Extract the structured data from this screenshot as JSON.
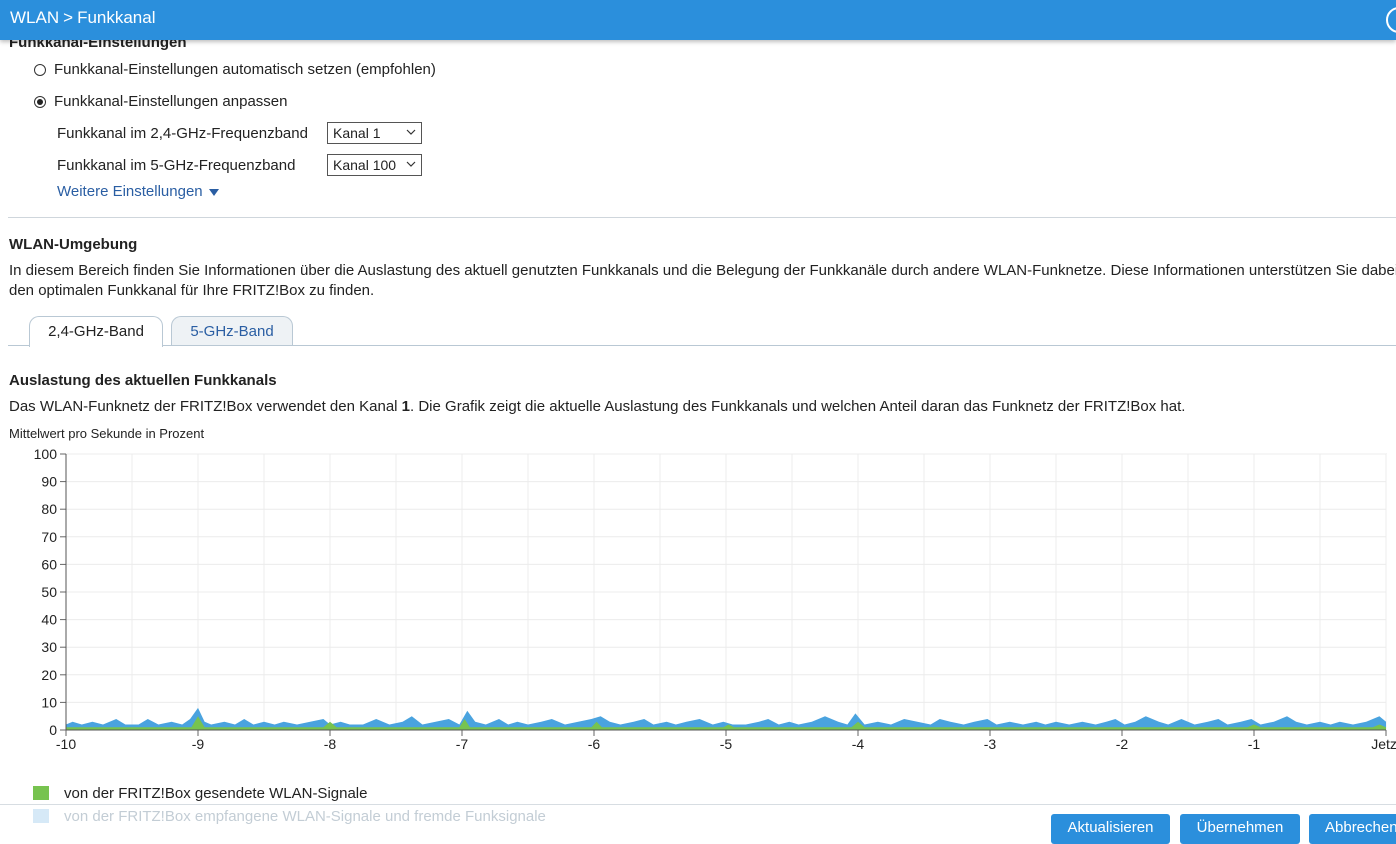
{
  "header": {
    "crumb_root": "WLAN",
    "crumb_separator": ">",
    "crumb_current": "Funkkanal"
  },
  "channel_settings": {
    "title": "Funkkanal-Einstellungen",
    "radio_auto": "Funkkanal-Einstellungen automatisch setzen (empfohlen)",
    "radio_manual": "Funkkanal-Einstellungen anpassen",
    "selected_option": "manual",
    "band24_label": "Funkkanal im 2,4-GHz-Frequenzband",
    "band24_value": "Kanal 1",
    "band5_label": "Funkkanal im 5-GHz-Frequenzband",
    "band5_value": "Kanal 100",
    "more_settings": "Weitere Einstellungen"
  },
  "environment": {
    "title": "WLAN-Umgebung",
    "description_line1": "In diesem Bereich finden Sie Informationen über die Auslastung des aktuell genutzten Funkkanals und die Belegung der Funkkanäle durch andere WLAN-Funknetze. Diese Informationen unterstützen Sie dabei,",
    "description_line2": "den optimalen Funkkanal für Ihre FRITZ!Box zu finden.",
    "tabs": [
      {
        "label": "2,4-GHz-Band",
        "active": true
      },
      {
        "label": "5-GHz-Band",
        "active": false
      }
    ]
  },
  "utilization": {
    "title": "Auslastung des aktuellen Funkkanals",
    "text_before": "Das WLAN-Funknetz der FRITZ!Box verwendet den Kanal ",
    "channel": "1",
    "text_after": ". Die Grafik zeigt die aktuelle Auslastung des Funkkanals und welchen Anteil daran das Funknetz der FRITZ!Box hat.",
    "chart_caption": "Mittelwert pro Sekunde in Prozent"
  },
  "legend": {
    "sent": "von der FRITZ!Box gesendete WLAN-Signale",
    "received": "von der FRITZ!Box empfangene WLAN-Signale und fremde Funksignale"
  },
  "buttons": {
    "refresh": "Aktualisieren",
    "apply": "Übernehmen",
    "cancel": "Abbrechen"
  },
  "colors": {
    "header": "#2b8fdc",
    "sent_signal": "#77c34f",
    "received_signal": "#4aa3df",
    "received_legend": "#d6e9f7",
    "link": "#2a5ea3"
  },
  "chart_data": {
    "type": "area",
    "y_ticks": [
      "100",
      "90",
      "80",
      "70",
      "60",
      "50",
      "40",
      "30",
      "20",
      "10",
      "0"
    ],
    "x_ticks": [
      "-10",
      "-9",
      "-8",
      "-7",
      "-6",
      "-5",
      "-4",
      "-3",
      "-2",
      "-1",
      "Jetzt"
    ],
    "ylim": [
      0,
      100
    ],
    "xlim": [
      -10,
      0
    ],
    "grid": true,
    "series": [
      {
        "name": "von der FRITZ!Box empfangene WLAN-Signale und fremde Funksignale",
        "color": "#4aa3df",
        "points": [
          [
            -10,
            2
          ],
          [
            -9.95,
            3
          ],
          [
            -9.88,
            2
          ],
          [
            -9.8,
            3
          ],
          [
            -9.72,
            2
          ],
          [
            -9.62,
            4
          ],
          [
            -9.55,
            2
          ],
          [
            -9.45,
            2
          ],
          [
            -9.38,
            4
          ],
          [
            -9.3,
            2
          ],
          [
            -9.2,
            3
          ],
          [
            -9.12,
            2
          ],
          [
            -9.06,
            4
          ],
          [
            -9.0,
            8
          ],
          [
            -8.95,
            3
          ],
          [
            -8.9,
            2
          ],
          [
            -8.8,
            3
          ],
          [
            -8.72,
            2
          ],
          [
            -8.65,
            4
          ],
          [
            -8.58,
            2
          ],
          [
            -8.5,
            3
          ],
          [
            -8.42,
            2
          ],
          [
            -8.35,
            3
          ],
          [
            -8.25,
            2
          ],
          [
            -8.15,
            3
          ],
          [
            -8.05,
            4
          ],
          [
            -8.0,
            2
          ],
          [
            -7.92,
            3
          ],
          [
            -7.85,
            2
          ],
          [
            -7.75,
            2
          ],
          [
            -7.65,
            4
          ],
          [
            -7.55,
            2
          ],
          [
            -7.45,
            3
          ],
          [
            -7.38,
            5
          ],
          [
            -7.3,
            2
          ],
          [
            -7.2,
            3
          ],
          [
            -7.1,
            4
          ],
          [
            -7.02,
            2
          ],
          [
            -6.96,
            7
          ],
          [
            -6.9,
            3
          ],
          [
            -6.82,
            2
          ],
          [
            -6.72,
            4
          ],
          [
            -6.65,
            2
          ],
          [
            -6.58,
            3
          ],
          [
            -6.5,
            2
          ],
          [
            -6.4,
            3
          ],
          [
            -6.32,
            4
          ],
          [
            -6.22,
            2
          ],
          [
            -6.12,
            3
          ],
          [
            -6.02,
            4
          ],
          [
            -5.95,
            5
          ],
          [
            -5.88,
            3
          ],
          [
            -5.8,
            2
          ],
          [
            -5.7,
            3
          ],
          [
            -5.62,
            4
          ],
          [
            -5.55,
            2
          ],
          [
            -5.45,
            3
          ],
          [
            -5.38,
            2
          ],
          [
            -5.3,
            3
          ],
          [
            -5.2,
            4
          ],
          [
            -5.1,
            2
          ],
          [
            -5.02,
            3
          ],
          [
            -4.95,
            2
          ],
          [
            -4.85,
            2
          ],
          [
            -4.75,
            3
          ],
          [
            -4.68,
            4
          ],
          [
            -4.6,
            2
          ],
          [
            -4.52,
            3
          ],
          [
            -4.45,
            2
          ],
          [
            -4.35,
            3
          ],
          [
            -4.25,
            5
          ],
          [
            -4.15,
            3
          ],
          [
            -4.08,
            2
          ],
          [
            -4.02,
            6
          ],
          [
            -3.95,
            2
          ],
          [
            -3.85,
            3
          ],
          [
            -3.75,
            2
          ],
          [
            -3.65,
            4
          ],
          [
            -3.55,
            3
          ],
          [
            -3.45,
            2
          ],
          [
            -3.38,
            4
          ],
          [
            -3.3,
            3
          ],
          [
            -3.2,
            2
          ],
          [
            -3.12,
            3
          ],
          [
            -3.02,
            4
          ],
          [
            -2.95,
            2
          ],
          [
            -2.85,
            3
          ],
          [
            -2.75,
            2
          ],
          [
            -2.65,
            3
          ],
          [
            -2.58,
            2
          ],
          [
            -2.5,
            3
          ],
          [
            -2.4,
            2
          ],
          [
            -2.3,
            3
          ],
          [
            -2.2,
            2
          ],
          [
            -2.12,
            3
          ],
          [
            -2.05,
            4
          ],
          [
            -1.98,
            2
          ],
          [
            -1.9,
            3
          ],
          [
            -1.82,
            5
          ],
          [
            -1.72,
            3
          ],
          [
            -1.65,
            2
          ],
          [
            -1.55,
            4
          ],
          [
            -1.45,
            2
          ],
          [
            -1.35,
            3
          ],
          [
            -1.27,
            4
          ],
          [
            -1.2,
            2
          ],
          [
            -1.1,
            3
          ],
          [
            -1.02,
            4
          ],
          [
            -0.95,
            2
          ],
          [
            -0.85,
            3
          ],
          [
            -0.75,
            5
          ],
          [
            -0.68,
            3
          ],
          [
            -0.6,
            2
          ],
          [
            -0.5,
            3
          ],
          [
            -0.42,
            2
          ],
          [
            -0.35,
            3
          ],
          [
            -0.25,
            2
          ],
          [
            -0.15,
            3
          ],
          [
            -0.05,
            5
          ],
          [
            0,
            3
          ]
        ]
      },
      {
        "name": "von der FRITZ!Box gesendete WLAN-Signale",
        "color": "#77c34f",
        "points": [
          [
            -10,
            1
          ],
          [
            -9.6,
            1
          ],
          [
            -9.05,
            1
          ],
          [
            -9.0,
            5
          ],
          [
            -8.95,
            1
          ],
          [
            -8.05,
            1
          ],
          [
            -8.0,
            3
          ],
          [
            -7.95,
            1
          ],
          [
            -7.02,
            1
          ],
          [
            -6.98,
            4
          ],
          [
            -6.94,
            1
          ],
          [
            -6.02,
            1
          ],
          [
            -5.98,
            3
          ],
          [
            -5.94,
            1
          ],
          [
            -5.02,
            1
          ],
          [
            -4.98,
            2
          ],
          [
            -4.94,
            1
          ],
          [
            -4.05,
            1
          ],
          [
            -4.0,
            3
          ],
          [
            -3.95,
            1
          ],
          [
            -3.0,
            1
          ],
          [
            -2.0,
            1
          ],
          [
            -1.05,
            1
          ],
          [
            -1.0,
            2
          ],
          [
            -0.95,
            1
          ],
          [
            -0.1,
            1
          ],
          [
            -0.05,
            2
          ],
          [
            0,
            1
          ]
        ]
      }
    ]
  }
}
